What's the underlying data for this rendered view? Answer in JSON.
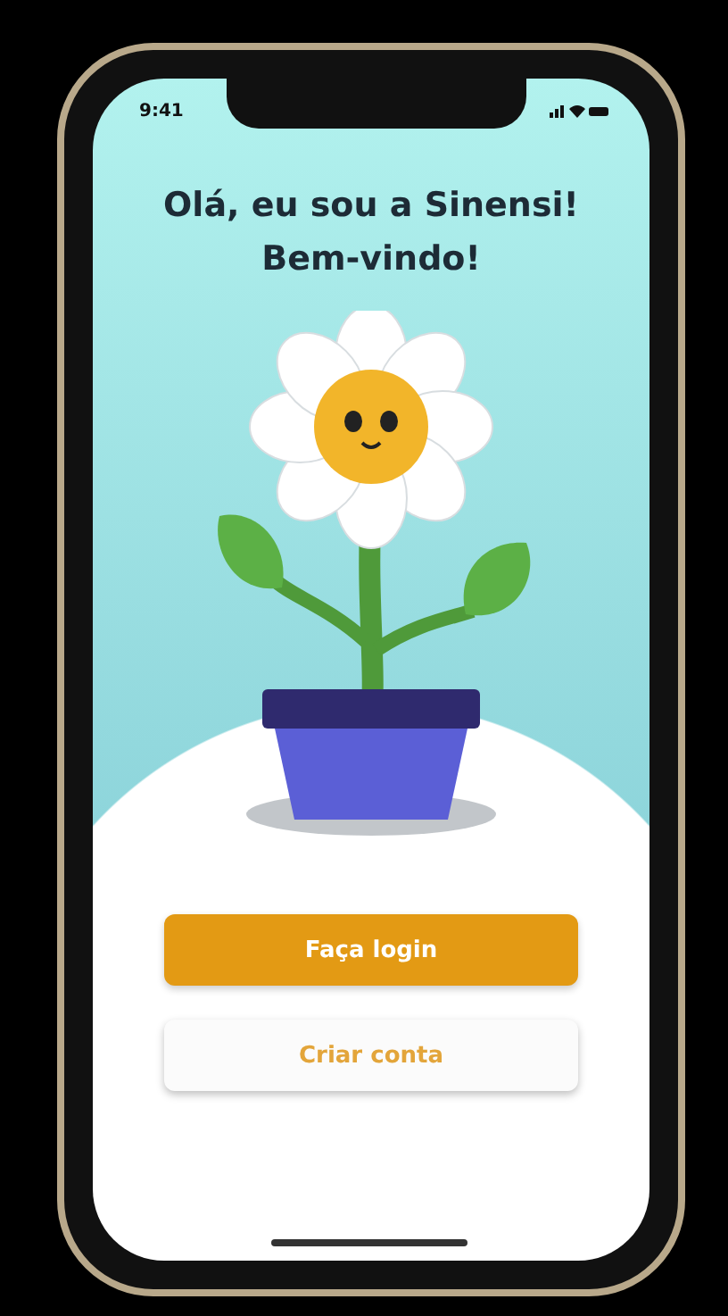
{
  "status_bar": {
    "time": "9:41"
  },
  "title_lines": [
    "Olá, eu sou a Sinensi!",
    "Bem-vindo!"
  ],
  "buttons": [
    {
      "label": "Faça login",
      "kind": "primary"
    },
    {
      "label": "Criar conta",
      "kind": "secondary"
    }
  ]
}
